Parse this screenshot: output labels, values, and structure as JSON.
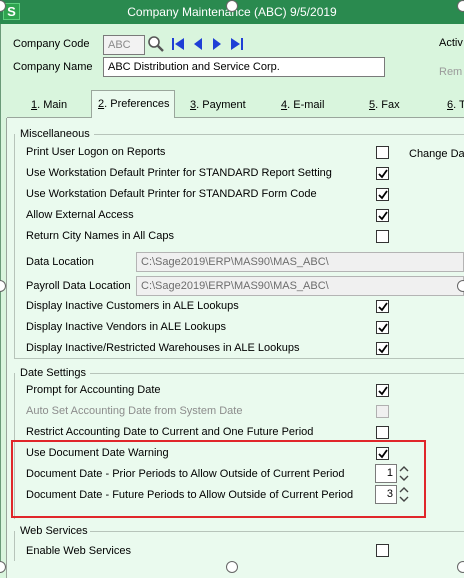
{
  "window": {
    "title": "Company Maintenance (ABC) 9/5/2019",
    "logo": "S"
  },
  "header": {
    "company_code_label": "Company Code",
    "company_code_value": "ABC",
    "company_name_label": "Company Name",
    "company_name_value": "ABC Distribution and Service Corp.",
    "active_label": "Activ",
    "remove_label": "Rem"
  },
  "tabs": [
    {
      "key": "1",
      "rest": ". Main"
    },
    {
      "key": "2",
      "rest": ". Preferences"
    },
    {
      "key": "3",
      "rest": ". Payment"
    },
    {
      "key": "4",
      "rest": ". E-mail"
    },
    {
      "key": "5",
      "rest": ". Fax"
    },
    {
      "key": "6",
      "rest": ". T"
    }
  ],
  "miscellaneous": {
    "title": "Miscellaneous",
    "change_label": "Change Da",
    "print_logon": {
      "label": "Print User Logon on Reports",
      "checked": false
    },
    "ws_report_printer": {
      "label": "Use Workstation Default Printer for STANDARD Report Setting",
      "checked": true
    },
    "ws_form_printer": {
      "label": "Use Workstation Default Printer for STANDARD Form Code",
      "checked": true
    },
    "external_access": {
      "label": "Allow External Access",
      "checked": true
    },
    "city_caps": {
      "label": "Return City Names in All Caps",
      "checked": false
    },
    "data_location": {
      "label": "Data Location",
      "value": "C:\\Sage2019\\ERP\\MAS90\\MAS_ABC\\"
    },
    "payroll_location": {
      "label": "Payroll Data Location",
      "value": "C:\\Sage2019\\ERP\\MAS90\\MAS_ABC\\"
    },
    "inactive_customers": {
      "label": "Display Inactive Customers in ALE Lookups",
      "checked": true
    },
    "inactive_vendors": {
      "label": "Display Inactive Vendors in ALE Lookups",
      "checked": true
    },
    "inactive_warehouses": {
      "label": "Display Inactive/Restricted Warehouses in ALE Lookups",
      "checked": true
    }
  },
  "date_settings": {
    "title": "Date Settings",
    "prompt_date": {
      "label": "Prompt for Accounting Date",
      "checked": true
    },
    "auto_set_date": {
      "label": "Auto Set Accounting Date from System Date",
      "checked": false,
      "disabled": true
    },
    "restrict_date": {
      "label": "Restrict Accounting Date to Current and One Future Period",
      "checked": false
    },
    "doc_date_warning": {
      "label": "Use Document Date Warning",
      "checked": true
    },
    "prior_periods": {
      "label": "Document Date - Prior Periods to Allow Outside of Current Period",
      "value": "1"
    },
    "future_periods": {
      "label": "Document Date - Future Periods to Allow Outside of Current Period",
      "value": "3"
    }
  },
  "web_services": {
    "title": "Web Services",
    "enable": {
      "label": "Enable Web Services",
      "checked": false
    }
  },
  "colors": {
    "titlebar": "#2a8a4f",
    "highlight": "#e0262a",
    "nav_arrow": "#1f3fd6"
  }
}
